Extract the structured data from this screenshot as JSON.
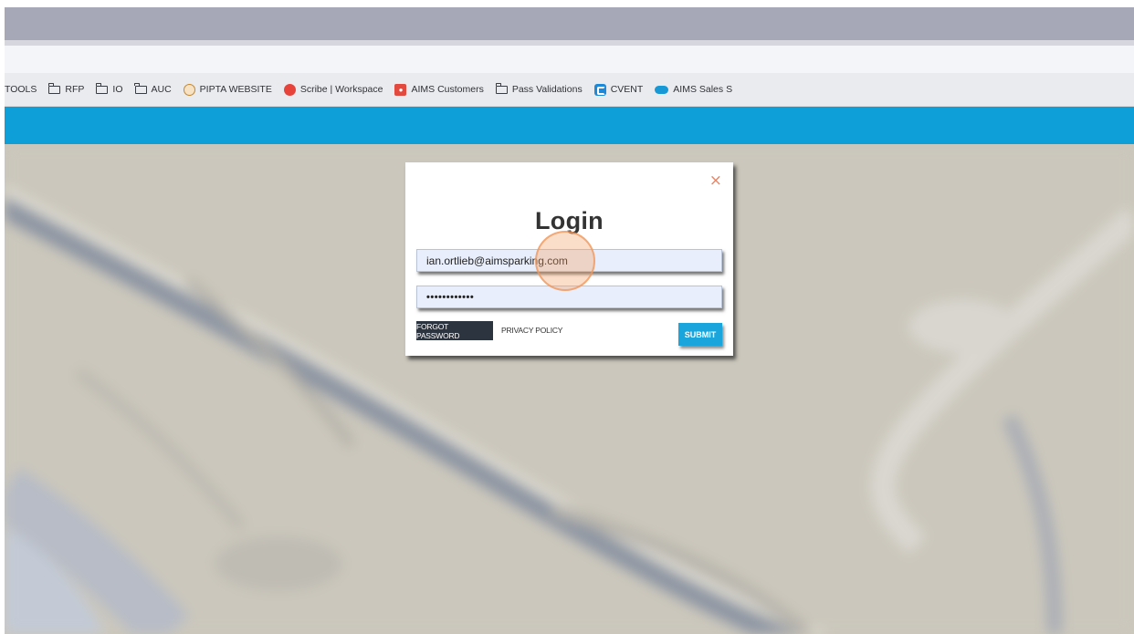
{
  "bookmarks": [
    {
      "label": "TOOLS",
      "icon": "none"
    },
    {
      "label": "RFP",
      "icon": "folder-icon"
    },
    {
      "label": "IO",
      "icon": "folder-icon"
    },
    {
      "label": "AUC",
      "icon": "folder-icon"
    },
    {
      "label": "PIPTA WEBSITE",
      "icon": "pipta-logo-icon"
    },
    {
      "label": "Scribe | Workspace",
      "icon": "scribe-logo-icon"
    },
    {
      "label": "AIMS Customers",
      "icon": "map-pin-icon"
    },
    {
      "label": "Pass Validations",
      "icon": "folder-icon"
    },
    {
      "label": "CVENT",
      "icon": "cvent-logo-icon"
    },
    {
      "label": "AIMS Sales S",
      "icon": "salesforce-cloud-icon"
    }
  ],
  "modal": {
    "close_symbol": "×",
    "title": "Login",
    "email_value": "ian.ortlieb@aimsparking.com",
    "password_value": "••••••••••••",
    "forgot_label": "FORGOT PASSWORD",
    "privacy_label": "PRIVACY POLICY",
    "submit_label": "SUBMIT"
  },
  "colors": {
    "header_bar": "#0f9fd8",
    "submit_button": "#1aa6dc",
    "forgot_button": "#2c3440",
    "close_icon": "#e2866a"
  }
}
